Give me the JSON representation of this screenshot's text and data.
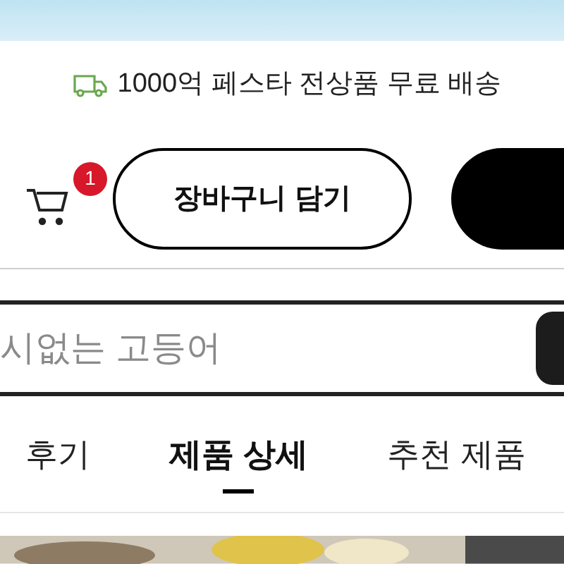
{
  "promo": {
    "text": "1000억 페스타 전상품 무료 배송"
  },
  "cart": {
    "badge": "1",
    "add_button": "장바구니 담기"
  },
  "search": {
    "placeholder": "시없는 고등어"
  },
  "tabs": [
    {
      "label": "후기",
      "selected": false
    },
    {
      "label": "제품 상세",
      "selected": true
    },
    {
      "label": "추천 제품",
      "selected": false
    }
  ]
}
